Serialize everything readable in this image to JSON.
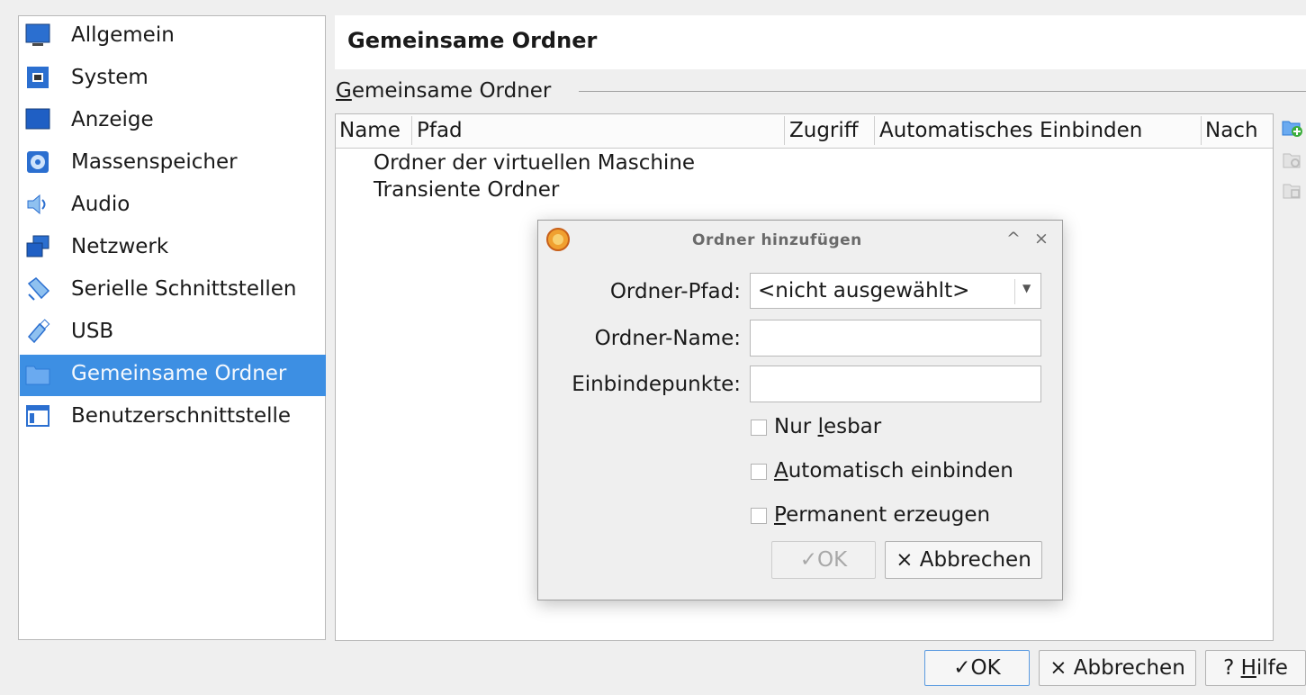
{
  "sidebar": {
    "items": [
      {
        "label": "Allgemein",
        "icon": "monitor-icon"
      },
      {
        "label": "System",
        "icon": "chip-icon"
      },
      {
        "label": "Anzeige",
        "icon": "display-icon"
      },
      {
        "label": "Massenspeicher",
        "icon": "disk-icon"
      },
      {
        "label": "Audio",
        "icon": "speaker-icon"
      },
      {
        "label": "Netzwerk",
        "icon": "network-icon"
      },
      {
        "label": "Serielle Schnittstellen",
        "icon": "serial-port-icon"
      },
      {
        "label": "USB",
        "icon": "usb-icon"
      },
      {
        "label": "Gemeinsame Ordner",
        "icon": "folder-icon",
        "selected": true
      },
      {
        "label": "Benutzerschnittstelle",
        "icon": "window-icon"
      }
    ]
  },
  "header": {
    "title": "Gemeinsame Ordner"
  },
  "group": {
    "legend_underlined": "G",
    "legend_rest": "emeinsame Ordner"
  },
  "table": {
    "columns": [
      "Name",
      "Pfad",
      "Zugriff",
      "Automatisches Einbinden",
      "Nach"
    ],
    "rows": [
      "Ordner der virtuellen Maschine",
      "Transiente Ordner"
    ]
  },
  "tools": [
    "add-folder-icon",
    "edit-folder-icon",
    "remove-folder-icon"
  ],
  "dialog": {
    "title": "Ordner hinzufügen",
    "minimize_glyph": "^",
    "close_glyph": "×",
    "path_label": "Ordner-Pfad:",
    "path_value": "<nicht ausgewählt>",
    "name_label": "Ordner-Name:",
    "name_value": "",
    "mount_label": "Einbindepunkte:",
    "mount_value": "",
    "readonly": {
      "pre": "Nur ",
      "u": "l",
      "post": "esbar",
      "checked": false
    },
    "automount": {
      "pre": "",
      "u": "A",
      "post": "utomatisch einbinden",
      "checked": false
    },
    "permanent": {
      "pre": "",
      "u": "P",
      "post": "ermanent erzeugen",
      "checked": false
    },
    "ok_label": "✓OK",
    "cancel_label": "× Abbrechen"
  },
  "footer": {
    "ok_label": "✓OK",
    "cancel_label": "× Abbrechen",
    "help_prefix": "? ",
    "help_underlined": "H",
    "help_rest": "ilfe"
  },
  "colors": {
    "selection": "#3d8fe3",
    "window_bg": "#efefef"
  }
}
